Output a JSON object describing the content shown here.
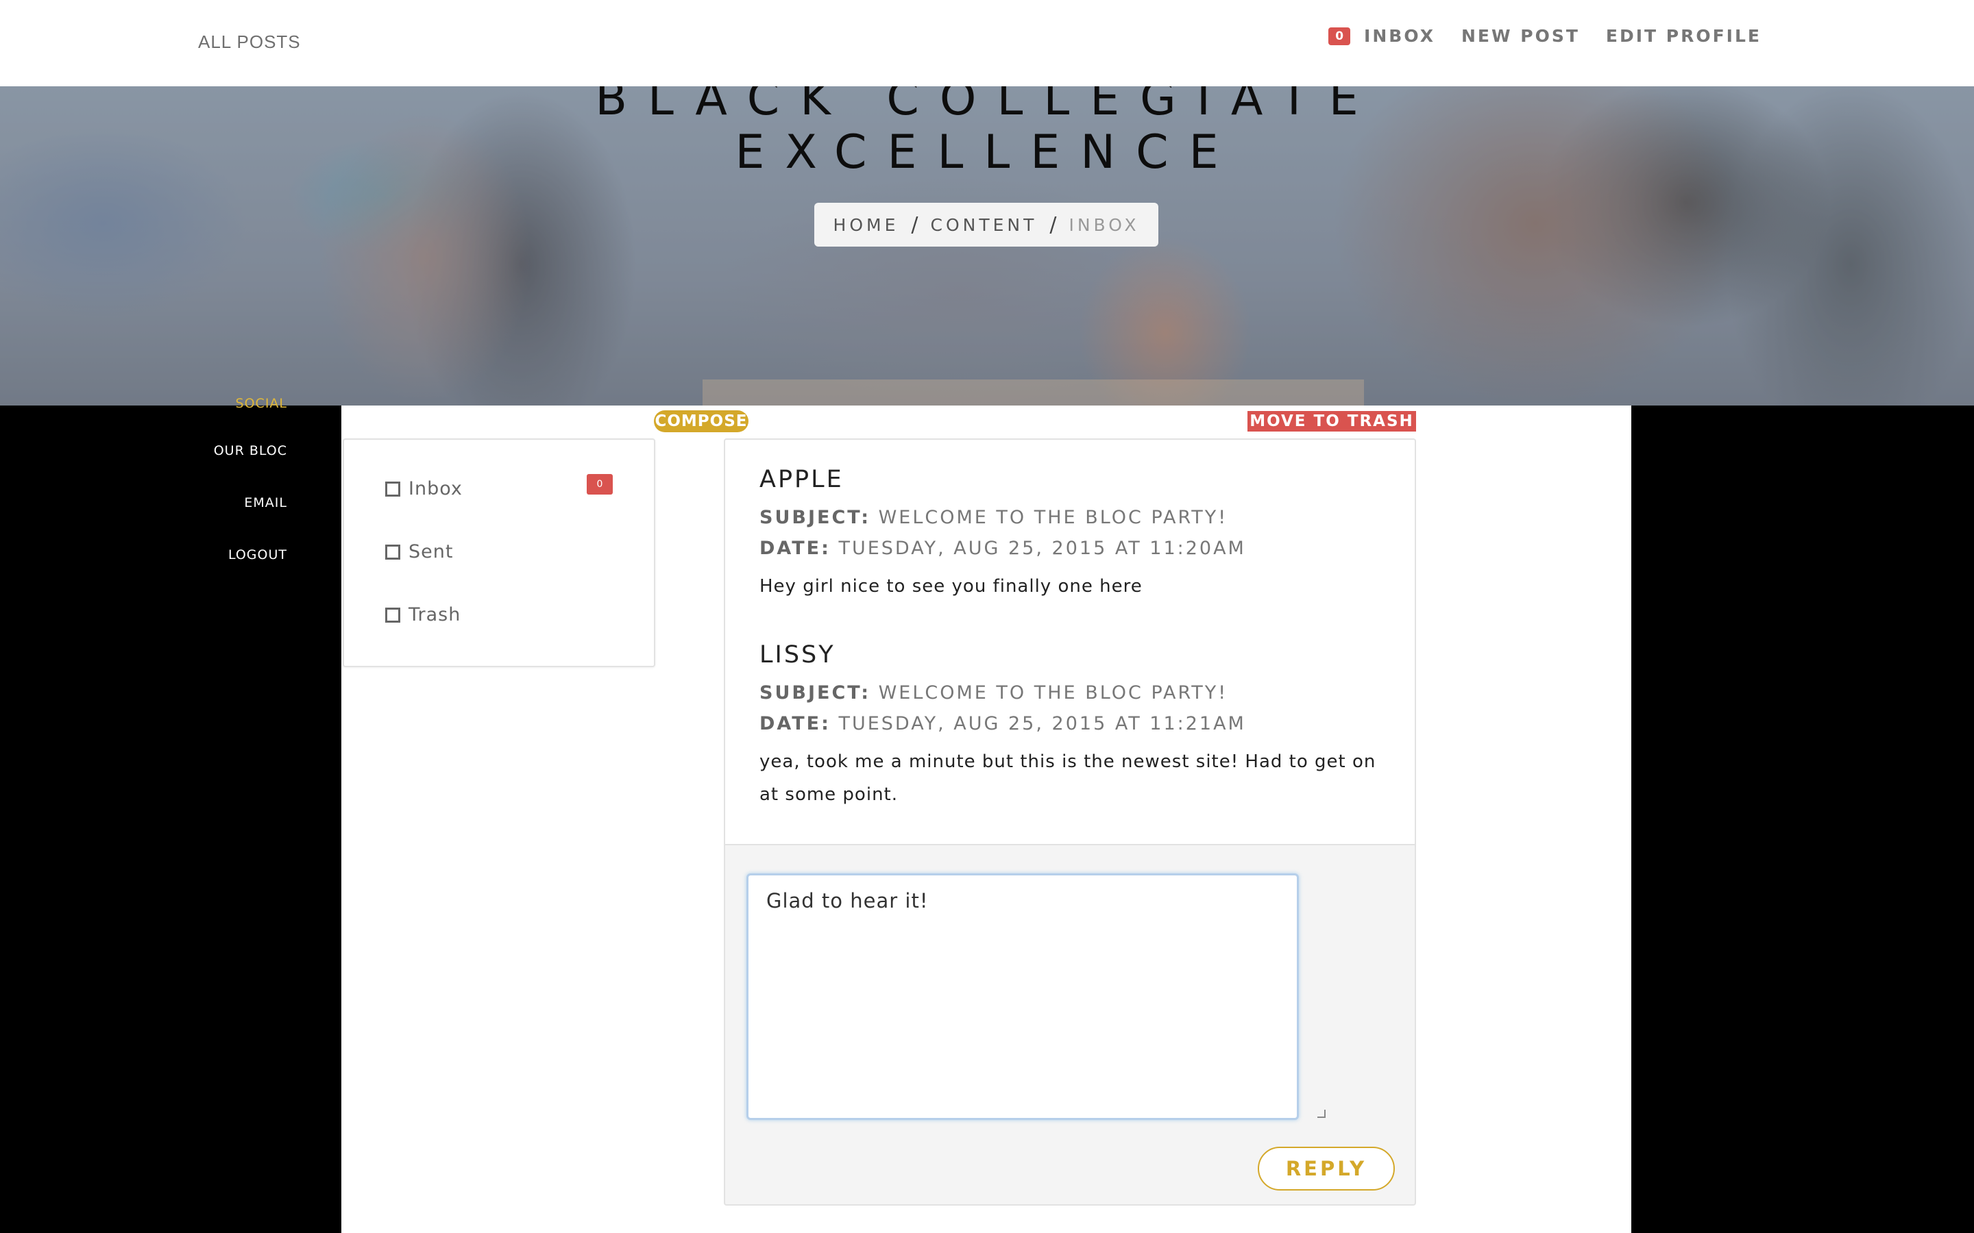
{
  "topbar": {
    "all_posts": "ALL POSTS",
    "inbox_badge": "0",
    "inbox": "INBOX",
    "new_post": "NEW POST",
    "edit_profile": "EDIT PROFILE"
  },
  "hero": {
    "title_line1": "BLACK COLLEGIATE",
    "title_line2": "EXCELLENCE",
    "breadcrumb": [
      "HOME",
      "CONTENT",
      "INBOX"
    ]
  },
  "sidebar": {
    "items": [
      "SOCIAL",
      "OUR BLOC",
      "EMAIL",
      "LOGOUT"
    ]
  },
  "toolbar": {
    "compose": "COMPOSE",
    "move_to_trash": "MOVE TO TRASH"
  },
  "folders": {
    "items": [
      {
        "label": "Inbox"
      },
      {
        "label": "Sent"
      },
      {
        "label": "Trash"
      }
    ],
    "inbox_badge": "0"
  },
  "messages": [
    {
      "sender": "APPLE",
      "subject_label": "SUBJECT:",
      "subject": "WELCOME TO THE BLOC PARTY!",
      "date_label": "DATE:",
      "date": "TUESDAY, AUG 25, 2015 AT 11:20AM",
      "body": "Hey girl nice to see you finally one here"
    },
    {
      "sender": "LISSY",
      "subject_label": "SUBJECT:",
      "subject": "WELCOME TO THE BLOC PARTY!",
      "date_label": "DATE:",
      "date": "TUESDAY, AUG 25, 2015 AT 11:21AM",
      "body": "yea, took me a minute but this is the newest site! Had to get on at some point."
    }
  ],
  "reply": {
    "value": "Glad to hear it!",
    "button": "REPLY"
  },
  "colors": {
    "accent_gold": "#d4a82a",
    "danger_red": "#d9534f"
  }
}
